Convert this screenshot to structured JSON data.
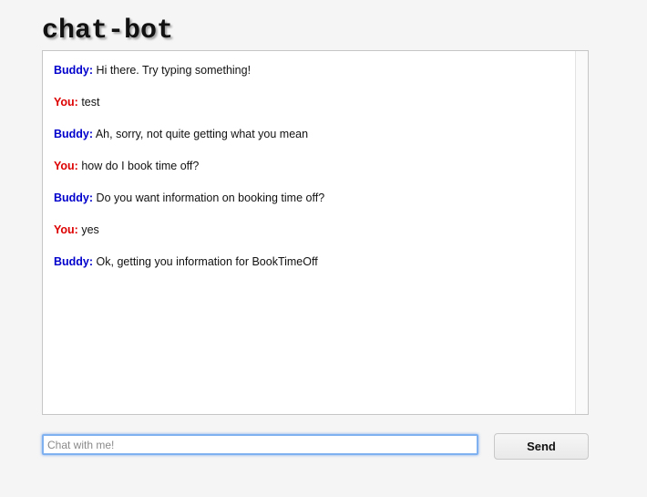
{
  "app": {
    "title": "chat-bot"
  },
  "conversation": {
    "messages": [
      {
        "speaker": "Buddy:",
        "text": " Hi there. Try typing something!"
      },
      {
        "speaker": "You:",
        "text": " test"
      },
      {
        "speaker": "Buddy:",
        "text": " Ah, sorry, not quite getting what you mean"
      },
      {
        "speaker": "You:",
        "text": " how do I book time off?"
      },
      {
        "speaker": "Buddy:",
        "text": " Do you want information on booking time off?"
      },
      {
        "speaker": "You:",
        "text": " yes"
      },
      {
        "speaker": "Buddy:",
        "text": " Ok, getting you information for BookTimeOff"
      }
    ]
  },
  "composer": {
    "input_value": "",
    "input_placeholder": "Chat with me!",
    "send_label": "Send"
  },
  "colors": {
    "bot_name": "#0000cc",
    "user_name": "#dd0000",
    "input_focus": "#7fb1f0"
  }
}
